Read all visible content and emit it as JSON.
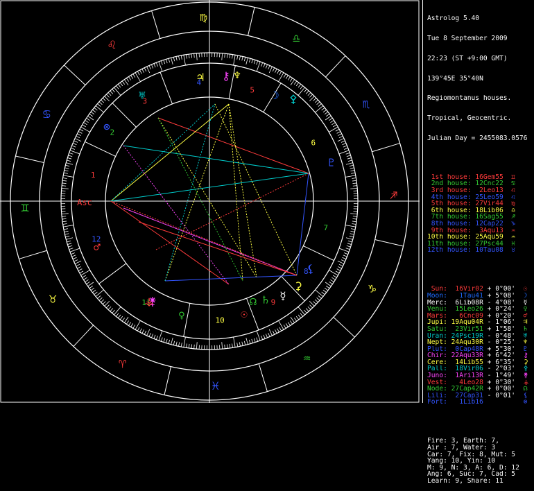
{
  "header": {
    "app": "Astrolog 5.40",
    "date": "Tue 8 September 2009",
    "time": "22:23 (ST +9:00 GMT)",
    "location": "139°45E 35°40N",
    "house_system": "Regiomontanus houses.",
    "zodiac": "Tropical, Geocentric.",
    "julian": "Julian Day = 2455083.0576"
  },
  "colors": {
    "fire": "#ff3b3b",
    "earth": "#ffff44",
    "air": "#33cc33",
    "water": "#3355ff",
    "blue": "#1e6bff",
    "cyan": "#00cccc",
    "magenta": "#ff44ff",
    "white": "#ffffff"
  },
  "houses": [
    {
      "label": "1st house:",
      "pos": "16Gem55",
      "color": "#ff3b3b",
      "glyph": "♊"
    },
    {
      "label": "2nd house:",
      "pos": "12Cnc22",
      "color": "#33cc33",
      "glyph": "♋"
    },
    {
      "label": "3rd house:",
      "pos": "2Leo13",
      "color": "#ff3b3b",
      "glyph": "♌"
    },
    {
      "label": "4th house:",
      "pos": "25Leo59",
      "color": "#3355ff",
      "glyph": "♌"
    },
    {
      "label": "5th house:",
      "pos": "27Vir44",
      "color": "#ff3b3b",
      "glyph": "♍"
    },
    {
      "label": "6th house:",
      "pos": "18Lib06",
      "color": "#ffff44",
      "glyph": "♎"
    },
    {
      "label": "7th house:",
      "pos": "16Sag55",
      "color": "#33cc33",
      "glyph": "♐"
    },
    {
      "label": "8th house:",
      "pos": "12Cap22",
      "color": "#3355ff",
      "glyph": "♑"
    },
    {
      "label": "9th house:",
      "pos": "3Aqu13",
      "color": "#ff3b3b",
      "glyph": "♒"
    },
    {
      "label": "10th house:",
      "pos": "25Aqu59",
      "color": "#ffff44",
      "glyph": "♒"
    },
    {
      "label": "11th house:",
      "pos": "27Psc44",
      "color": "#33cc33",
      "glyph": "♓"
    },
    {
      "label": "12th house:",
      "pos": "10Tau08",
      "color": "#3355ff",
      "glyph": "♉"
    }
  ],
  "planets": [
    {
      "name": "Sun:",
      "pos": "16Vir02",
      "lat": "+ 0°00'",
      "color": "#ff3b3b",
      "glyph": "☉"
    },
    {
      "name": "Moon:",
      "pos": "1Tau41",
      "lat": "+ 5°08'",
      "color": "#1e6bff",
      "glyph": "☽"
    },
    {
      "name": "Merc:",
      "pos": "6Lib08R",
      "lat": "- 4°08'",
      "color": "#ffffff",
      "glyph": "☿"
    },
    {
      "name": "Venu:",
      "pos": "15Leo26",
      "lat": "+ 0°24'",
      "color": "#33cc33",
      "glyph": "♀"
    },
    {
      "name": "Mars:",
      "pos": "6Cnc09",
      "lat": "+ 0°20'",
      "color": "#ff3b3b",
      "glyph": "♂"
    },
    {
      "name": "Jupi:",
      "pos": "19Aqu04R",
      "lat": "- 1°06'",
      "color": "#ffff44",
      "glyph": "♃"
    },
    {
      "name": "Satu:",
      "pos": "23Vir51",
      "lat": "+ 1°58'",
      "color": "#33cc33",
      "glyph": "♄"
    },
    {
      "name": "Uran:",
      "pos": "24Psc19R",
      "lat": "- 0°48'",
      "color": "#00cccc",
      "glyph": "♅"
    },
    {
      "name": "Nept:",
      "pos": "24Aqu30R",
      "lat": "- 0°25'",
      "color": "#ffff44",
      "glyph": "♆"
    },
    {
      "name": "Plut:",
      "pos": "0Cap48R",
      "lat": "+ 5°30'",
      "color": "#3355ff",
      "glyph": "♇"
    },
    {
      "name": "Chir:",
      "pos": "22Aqu33R",
      "lat": "+ 6°42'",
      "color": "#ff44ff",
      "glyph": "⚷"
    },
    {
      "name": "Cere:",
      "pos": "14Lib55",
      "lat": "+ 6°35'",
      "color": "#ffff44",
      "glyph": "⚳"
    },
    {
      "name": "Pall:",
      "pos": "18Vir06",
      "lat": "- 2°03'",
      "color": "#00cccc",
      "glyph": "⚴"
    },
    {
      "name": "Juno:",
      "pos": "1Ari13R",
      "lat": "- 1°49'",
      "color": "#ff44ff",
      "glyph": "⚵"
    },
    {
      "name": "Vest:",
      "pos": "4Leo28",
      "lat": "+ 0°30'",
      "color": "#ff3b3b",
      "glyph": "⚶"
    },
    {
      "name": "Node:",
      "pos": "27Cap42R",
      "lat": "+ 0°00'",
      "color": "#33cc33",
      "glyph": "☊"
    },
    {
      "name": "Lili:",
      "pos": "27Cap31",
      "lat": "- 0°01'",
      "color": "#3355ff",
      "glyph": "⚸"
    },
    {
      "name": "Fort:",
      "pos": "1Lib16",
      "lat": "",
      "color": "#3355ff",
      "glyph": "⊗"
    }
  ],
  "summary": [
    "Fire: 3, Earth: 7,",
    "Air : 7, Water: 3",
    "Car: 7, Fix: 8, Mut: 5",
    "Yang: 10, Yin: 10",
    "M: 9, N: 3, A: 6, D: 12",
    "Ang: 6, Suc: 7, Cad: 5",
    "Learn: 9, Share: 11"
  ],
  "wheel": {
    "asc_label": "Asc",
    "house_numbers": [
      "1",
      "2",
      "3",
      "4",
      "5",
      "6",
      "7",
      "8",
      "9",
      "10",
      "11",
      "12"
    ],
    "signs": [
      "♈",
      "♉",
      "♊",
      "♋",
      "♌",
      "♍",
      "♎",
      "♏",
      "♐",
      "♑",
      "♒",
      "♓"
    ]
  }
}
